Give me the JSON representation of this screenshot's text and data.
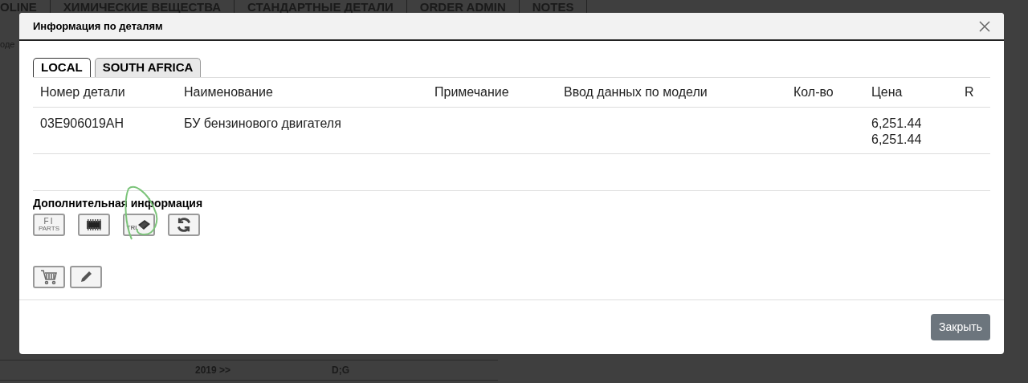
{
  "background": {
    "tabs": [
      "OLINE",
      "ХИМИЧЕСКИЕ ВЕЩЕСТВА",
      "СТАНДАРТНЫЕ ДЕТАЛИ",
      "ORDER ADMIN",
      "NOTES"
    ],
    "side_text": "оде",
    "bottom_row": [
      "2019 >>",
      "D;G"
    ]
  },
  "dialog": {
    "title": "Информация по деталям",
    "tabs": [
      {
        "label": "LOCAL",
        "selected": true
      },
      {
        "label": "SOUTH AFRICA",
        "selected": false
      }
    ],
    "table": {
      "columns": [
        "Номер детали",
        "Наименование",
        "Примечание",
        "Ввод данных по модели",
        "Кол-во",
        "Цена",
        "R"
      ],
      "rows": [
        [
          "03E906019AH",
          "БУ бензинового двигателя",
          "",
          "",
          "",
          [
            "6,251.44",
            "6,251.44"
          ],
          ""
        ]
      ]
    },
    "extra_title": "Дополнительная информация",
    "tool_buttons": [
      {
        "kind": "fi_parts",
        "labels": [
          "FI",
          "PARTS"
        ]
      },
      {
        "kind": "chip"
      },
      {
        "kind": "tri_book",
        "labels": [
          "TRI"
        ]
      },
      {
        "kind": "refresh"
      }
    ],
    "action_buttons": [
      {
        "kind": "cart"
      },
      {
        "kind": "pencil"
      }
    ],
    "close_button": "Закрыть"
  }
}
